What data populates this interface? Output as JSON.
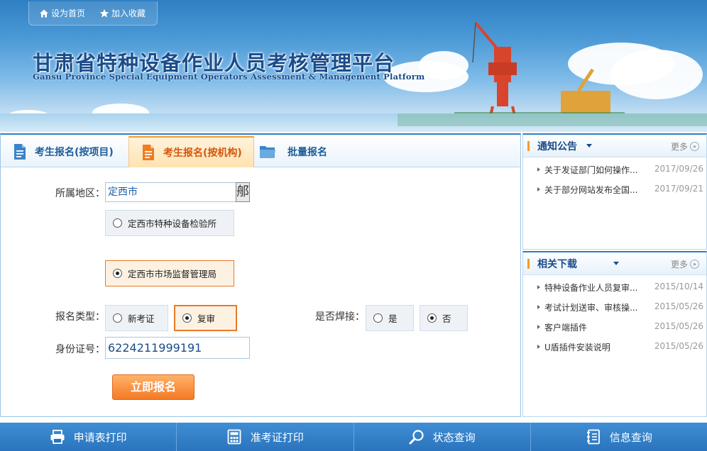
{
  "topbar": {
    "set_home": "设为首页",
    "add_favorite": "加入收藏"
  },
  "banner": {
    "title": "甘肃省特种设备作业人员考核管理平台",
    "subtitle": "Gansu Province Special Equipment Operators Assessment & Management Platform"
  },
  "tabs": [
    {
      "label": "考生报名(按项目)",
      "icon": "document-icon",
      "active": false
    },
    {
      "label": "考生报名(按机构)",
      "icon": "document-icon",
      "active": true
    },
    {
      "label": "批量报名",
      "icon": "folder-icon",
      "active": false
    }
  ],
  "form": {
    "region_label": "所属地区：",
    "region_value": "定西市",
    "region_button": "郍",
    "institutions": [
      {
        "label": "定西市特种设备检验所",
        "checked": false
      },
      {
        "label": "定西市市场监督管理局",
        "checked": true
      }
    ],
    "type_label": "报名类型：",
    "type_options": [
      {
        "label": "新考证",
        "checked": false
      },
      {
        "label": "复审",
        "checked": true
      }
    ],
    "welding_label": "是否焊接：",
    "welding_options": [
      {
        "label": "是",
        "checked": false
      },
      {
        "label": "否",
        "checked": true
      }
    ],
    "id_label": "身份证号：",
    "id_value": "6224211999191",
    "submit": "立即报名"
  },
  "notices": {
    "title": "通知公告",
    "more": "更多",
    "items": [
      {
        "title": "关于发证部门如何操作...",
        "date": "2017/09/26"
      },
      {
        "title": "关于部分网站发布全国...",
        "date": "2017/09/21"
      }
    ]
  },
  "downloads": {
    "title": "相关下载",
    "more": "更多",
    "items": [
      {
        "title": "特种设备作业人员复审...",
        "date": "2015/10/14"
      },
      {
        "title": "考试计划送审、审核操...",
        "date": "2015/05/26"
      },
      {
        "title": "客户端插件",
        "date": "2015/05/26"
      },
      {
        "title": "U盾插件安装说明",
        "date": "2015/05/26"
      }
    ]
  },
  "bottom_nav": [
    {
      "label": "申请表打印",
      "icon": "printer-icon"
    },
    {
      "label": "准考证打印",
      "icon": "calculator-icon"
    },
    {
      "label": "状态查询",
      "icon": "magnifier-icon"
    },
    {
      "label": "信息查询",
      "icon": "notebook-icon"
    }
  ],
  "colors": {
    "primary_blue": "#2f7dc1",
    "accent_orange": "#f47a24",
    "title_blue": "#1a4c8a"
  }
}
